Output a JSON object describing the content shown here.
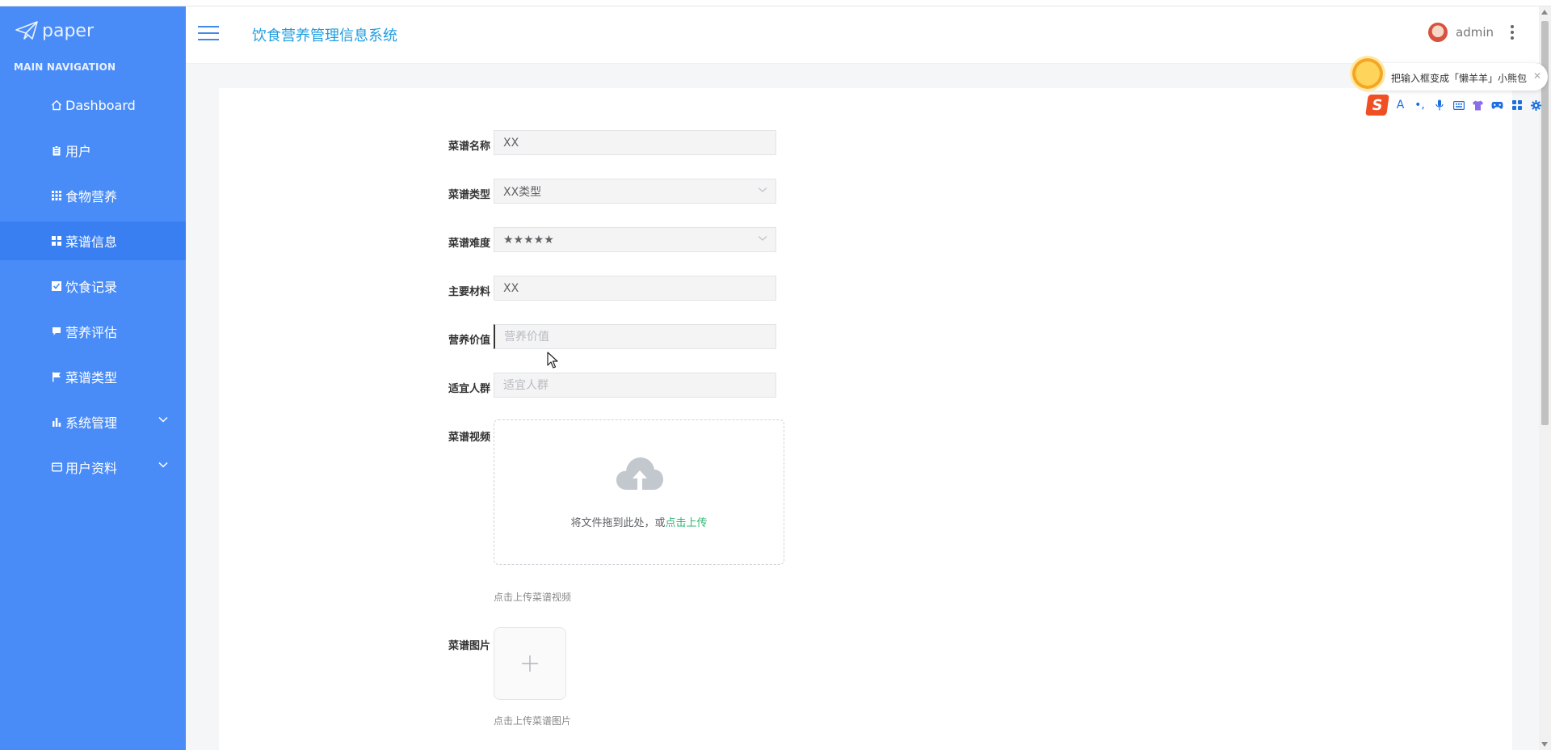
{
  "brand": {
    "name": "paper"
  },
  "sidebar": {
    "heading": "MAIN NAVIGATION",
    "items": [
      {
        "label": "Dashboard",
        "icon": "home-icon"
      },
      {
        "label": "用户",
        "icon": "clipboard-icon"
      },
      {
        "label": "食物营养",
        "icon": "grid-icon"
      },
      {
        "label": "菜谱信息",
        "icon": "apps-icon",
        "active": true
      },
      {
        "label": "饮食记录",
        "icon": "checkbox-icon"
      },
      {
        "label": "营养评估",
        "icon": "comment-icon"
      },
      {
        "label": "菜谱类型",
        "icon": "flag-icon"
      },
      {
        "label": "系统管理",
        "icon": "bar-chart-icon",
        "expandable": true
      },
      {
        "label": "用户资料",
        "icon": "card-icon",
        "expandable": true
      }
    ]
  },
  "header": {
    "title": "饮食营养管理信息系统",
    "username": "admin"
  },
  "form": {
    "name": {
      "label": "菜谱名称",
      "value": "XX"
    },
    "type": {
      "label": "菜谱类型",
      "value": "XX类型"
    },
    "difficulty": {
      "label": "菜谱难度",
      "value": "★★★★★"
    },
    "material": {
      "label": "主要材料",
      "value": "XX"
    },
    "nutrition": {
      "label": "营养价值",
      "placeholder": "营养价值"
    },
    "crowd": {
      "label": "适宜人群",
      "placeholder": "适宜人群"
    },
    "video": {
      "label": "菜谱视频",
      "drag_text": "将文件拖到此处，或",
      "click_text": "点击上传",
      "tip": "点击上传菜谱视频"
    },
    "image": {
      "label": "菜谱图片",
      "tip": "点击上传菜谱图片"
    }
  },
  "ime": {
    "tip": "把输入框变成「懒羊羊」小熊包",
    "logo": "S",
    "font_btn": "A",
    "punct_btn": "•,"
  },
  "colors": {
    "sidebar": "#4a8cf7",
    "sidebar_active": "#3a7ff2",
    "title": "#1f9de0",
    "link": "#2bb673"
  }
}
